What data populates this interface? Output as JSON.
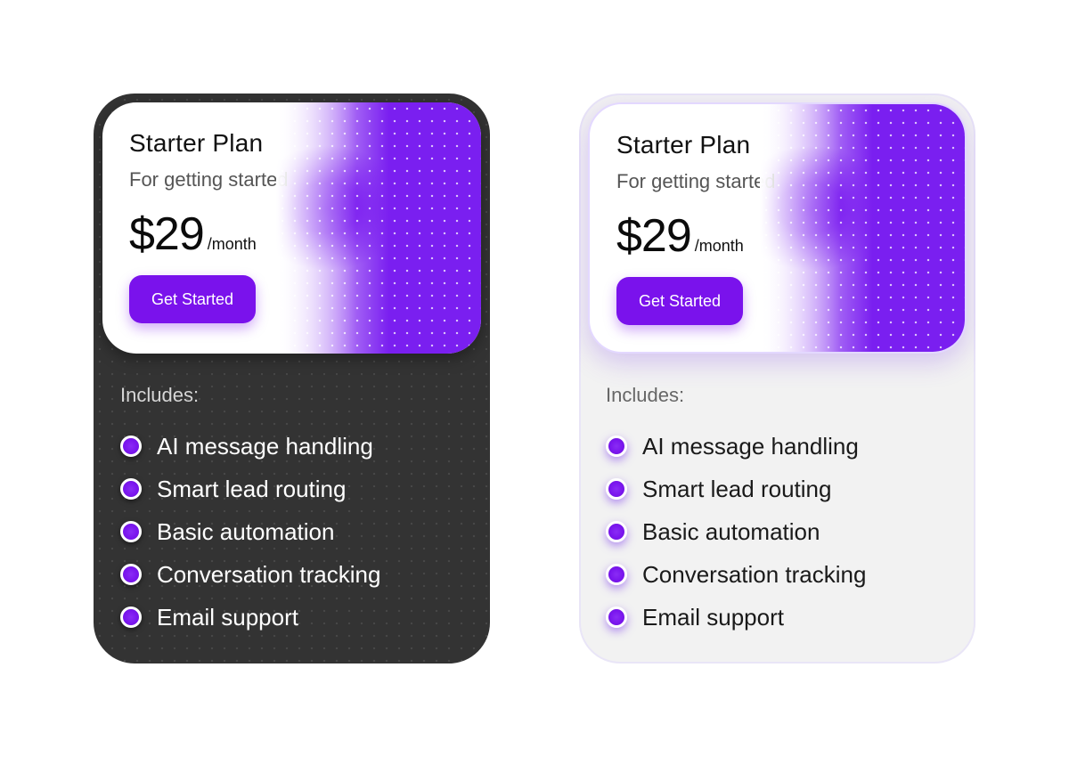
{
  "colors": {
    "accent": "#7a12ec",
    "dark_card_bg": "#333333",
    "light_card_bg": "#f2f2f2"
  },
  "cards": [
    {
      "theme": "dark",
      "title": "Starter Plan",
      "subtitle": "For getting started",
      "price": "$29",
      "period": "/month",
      "cta_label": "Get Started",
      "includes_label": "Includes:",
      "features": [
        "AI message handling",
        "Smart lead routing",
        "Basic automation",
        "Conversation tracking",
        "Email support"
      ],
      "bullet_icon": "check-dot-icon"
    },
    {
      "theme": "light",
      "title": "Starter Plan",
      "subtitle": "For getting started",
      "price": "$29",
      "period": "/month",
      "cta_label": "Get Started",
      "includes_label": "Includes:",
      "features": [
        "AI message handling",
        "Smart lead routing",
        "Basic automation",
        "Conversation tracking",
        "Email support"
      ],
      "bullet_icon": "check-dot-icon"
    }
  ]
}
